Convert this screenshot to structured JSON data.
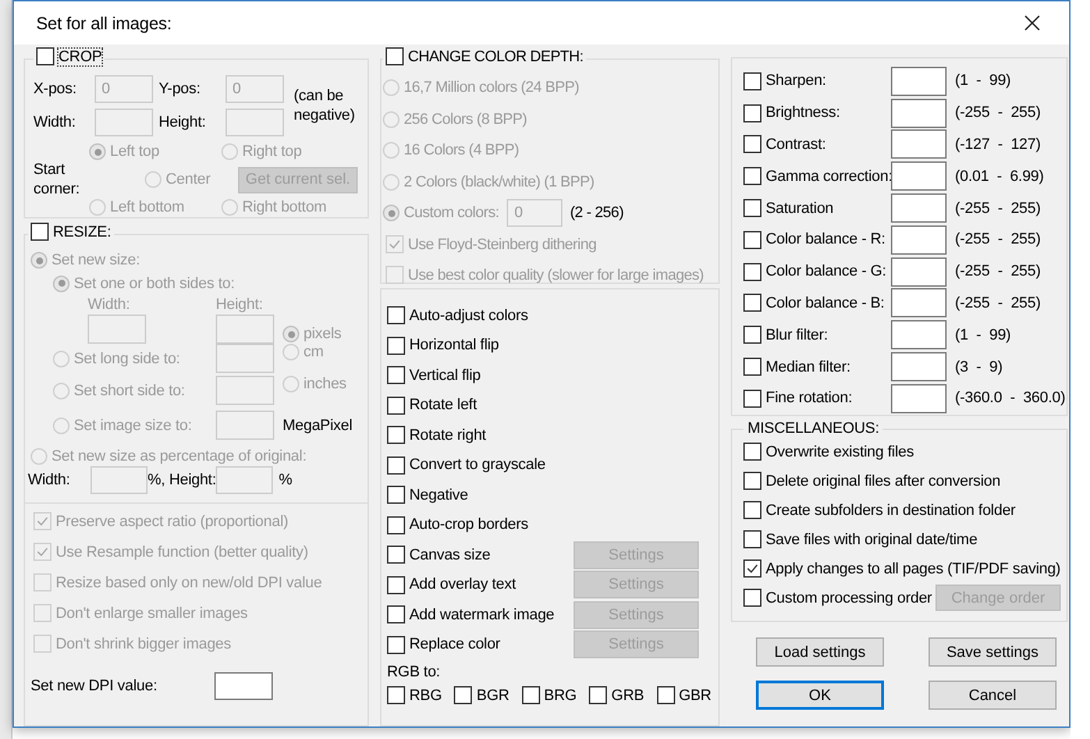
{
  "window": {
    "title": "Set for all images:"
  },
  "crop": {
    "label": "CROP",
    "checked": false,
    "disabled": true,
    "x_label": "X-pos:",
    "x_value": "0",
    "y_label": "Y-pos:",
    "y_value": "0",
    "note": "(can be negative)",
    "width_label": "Width:",
    "height_label": "Height:",
    "corner_label": "Start corner:",
    "corners": [
      {
        "label": "Left top",
        "selected": true
      },
      {
        "label": "Right top",
        "selected": false
      },
      {
        "label": "Center",
        "selected": false
      },
      {
        "label": "Left bottom",
        "selected": false
      },
      {
        "label": "Right bottom",
        "selected": false
      }
    ],
    "button": "Get current sel."
  },
  "resize": {
    "label": "RESIZE:",
    "checked": false,
    "disabled": true,
    "modes": [
      {
        "label": "Set new size:",
        "selected": true
      },
      {
        "label": "Set new size as percentage of original:",
        "selected": false
      }
    ],
    "sides": [
      {
        "label": "Set one or both sides to:",
        "selected": true
      },
      {
        "label": "Set long side to:",
        "selected": false
      },
      {
        "label": "Set short side to:",
        "selected": false
      },
      {
        "label": "Set image size to:",
        "selected": false
      }
    ],
    "width_label": "Width:",
    "height_label": "Height:",
    "units": [
      {
        "label": "pixels",
        "selected": true
      },
      {
        "label": "cm",
        "selected": false
      },
      {
        "label": "inches",
        "selected": false
      }
    ],
    "megapixel": "MegaPixel",
    "pct_width_label": "Width:",
    "pct_separator": "%, Height:",
    "pct_unit": "%",
    "options": [
      {
        "label": "Preserve aspect ratio (proportional)",
        "checked": true
      },
      {
        "label": "Use Resample function (better quality)",
        "checked": true
      },
      {
        "label": "Resize based only on new/old DPI value",
        "checked": false
      },
      {
        "label": "Don't enlarge smaller images",
        "checked": false
      },
      {
        "label": "Don't shrink bigger images",
        "checked": false
      }
    ],
    "dpi_label": "Set new DPI value:"
  },
  "color_depth": {
    "label": "CHANGE COLOR DEPTH:",
    "checked": false,
    "disabled": true,
    "depths": [
      {
        "label": "16,7 Million colors (24 BPP)",
        "selected": false
      },
      {
        "label": "256 Colors (8 BPP)",
        "selected": false
      },
      {
        "label": "16 Colors (4 BPP)",
        "selected": false
      },
      {
        "label": "2 Colors (black/white) (1 BPP)",
        "selected": false
      },
      {
        "label": "Custom colors:",
        "selected": true
      }
    ],
    "custom_value": "0",
    "custom_range": "(2 - 256)",
    "options": [
      {
        "label": "Use Floyd-Steinberg dithering",
        "checked": true
      },
      {
        "label": "Use best color quality (slower for large images)",
        "checked": false
      }
    ]
  },
  "transforms": {
    "items": [
      {
        "label": "Auto-adjust colors",
        "checked": false
      },
      {
        "label": "Horizontal flip",
        "checked": false
      },
      {
        "label": "Vertical flip",
        "checked": false
      },
      {
        "label": "Rotate left",
        "checked": false
      },
      {
        "label": "Rotate right",
        "checked": false
      },
      {
        "label": "Convert to grayscale",
        "checked": false
      },
      {
        "label": "Negative",
        "checked": false
      },
      {
        "label": "Auto-crop borders",
        "checked": false
      },
      {
        "label": "Canvas size",
        "checked": false,
        "button": "Settings",
        "button_disabled": true
      },
      {
        "label": "Add overlay text",
        "checked": false,
        "button": "Settings",
        "button_disabled": true
      },
      {
        "label": "Add watermark image",
        "checked": false,
        "button": "Settings",
        "button_disabled": true
      },
      {
        "label": "Replace color",
        "checked": false,
        "button": "Settings",
        "button_disabled": true
      }
    ],
    "rgb_label": "RGB to:",
    "rgb": [
      {
        "label": "RBG",
        "checked": false
      },
      {
        "label": "BGR",
        "checked": false
      },
      {
        "label": "BRG",
        "checked": false
      },
      {
        "label": "GRB",
        "checked": false
      },
      {
        "label": "GBR",
        "checked": false
      }
    ]
  },
  "adjustments": [
    {
      "label": "Sharpen:",
      "checked": false,
      "range": "(1  -  99)"
    },
    {
      "label": "Brightness:",
      "checked": false,
      "range": "(-255  -  255)"
    },
    {
      "label": "Contrast:",
      "checked": false,
      "range": "(-127  -  127)"
    },
    {
      "label": "Gamma correction:",
      "checked": false,
      "range": "(0.01  -  6.99)"
    },
    {
      "label": "Saturation",
      "checked": false,
      "range": "(-255  -  255)"
    },
    {
      "label": "Color balance - R:",
      "checked": false,
      "range": "(-255  -  255)"
    },
    {
      "label": "Color balance - G:",
      "checked": false,
      "range": "(-255  -  255)"
    },
    {
      "label": "Color balance - B:",
      "checked": false,
      "range": "(-255  -  255)"
    },
    {
      "label": "Blur filter:",
      "checked": false,
      "range": "(1  -  99)"
    },
    {
      "label": "Median filter:",
      "checked": false,
      "range": "(3  -  9)"
    },
    {
      "label": "Fine rotation:",
      "checked": false,
      "range": "(-360.0  -  360.0)"
    }
  ],
  "miscellaneous": {
    "title": "MISCELLANEOUS:",
    "items": [
      {
        "label": "Overwrite existing files",
        "checked": false
      },
      {
        "label": "Delete original files after conversion",
        "checked": false
      },
      {
        "label": "Create subfolders in destination folder",
        "checked": false
      },
      {
        "label": "Save files with original date/time",
        "checked": false
      },
      {
        "label": "Apply changes to all pages (TIF/PDF saving)",
        "checked": true
      },
      {
        "label": "Custom processing order",
        "checked": false,
        "button": "Change order",
        "button_disabled": true
      }
    ]
  },
  "buttons": [
    {
      "label": "Load settings",
      "default": false
    },
    {
      "label": "Save settings",
      "default": false
    },
    {
      "label": "OK",
      "default": true
    },
    {
      "label": "Cancel",
      "default": false
    }
  ]
}
